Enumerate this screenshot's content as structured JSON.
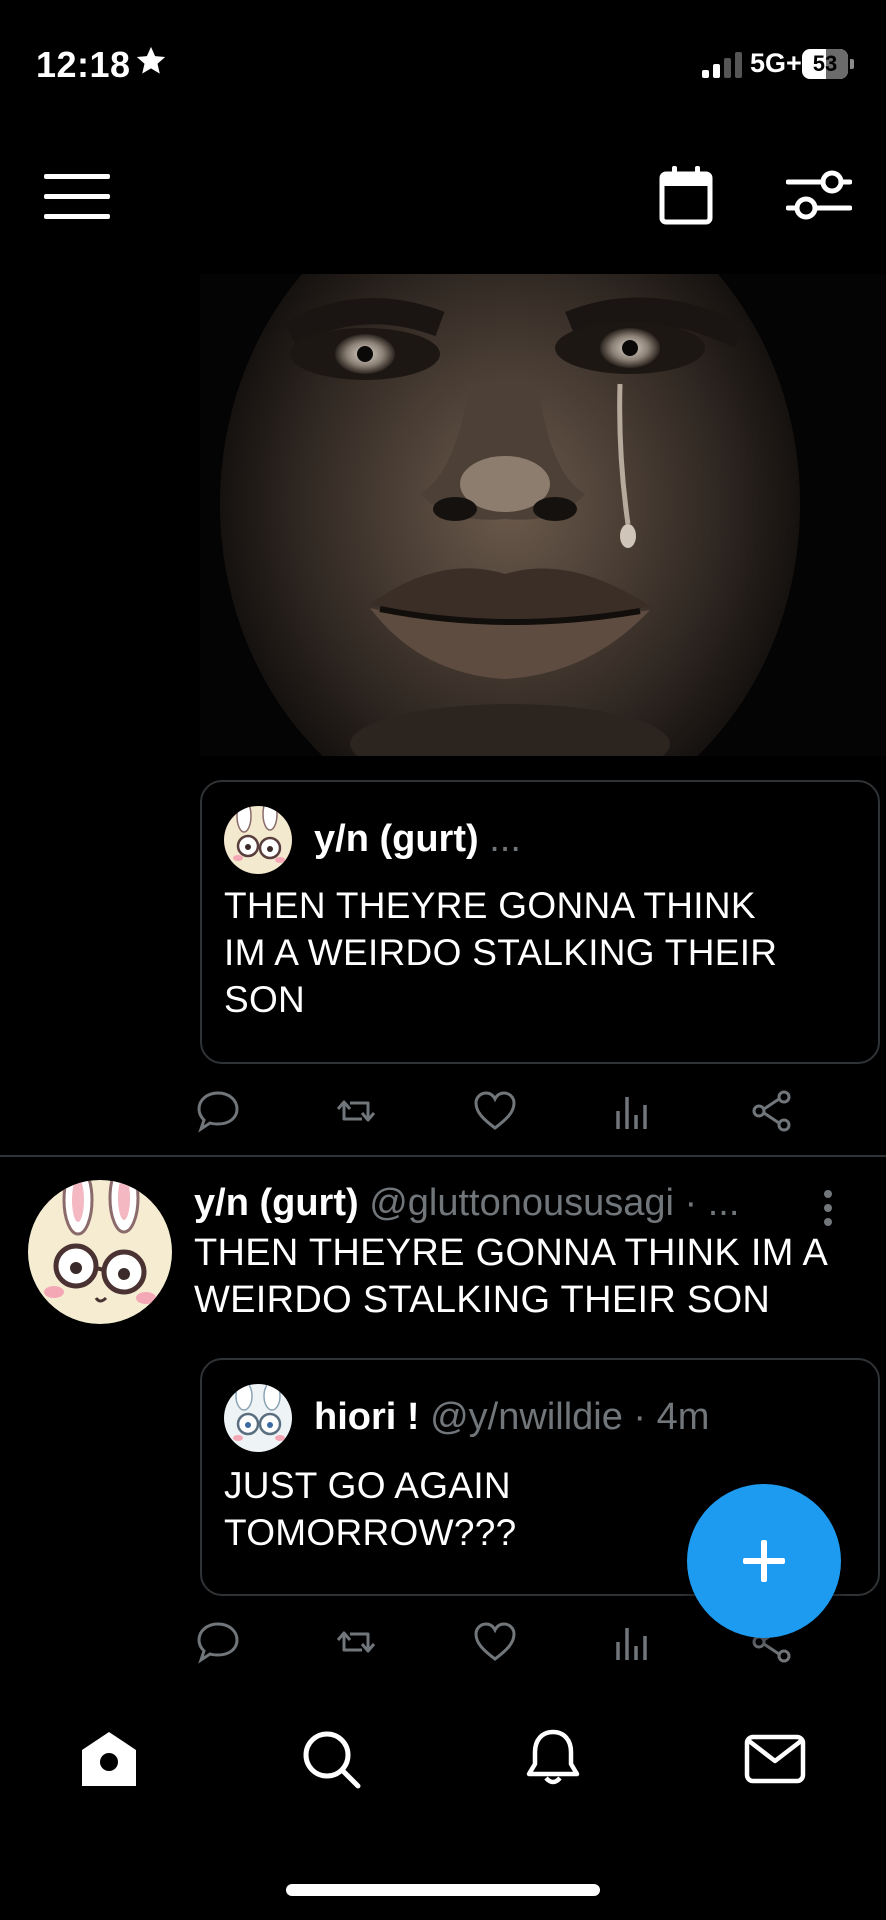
{
  "status": {
    "time": "12:18",
    "network": "5G+",
    "battery": "53",
    "battery_level": 0.53
  },
  "header": {
    "menu_icon": "hamburger-menu-icon",
    "calendar_icon": "calendar-icon",
    "filter_icon": "sliders-icon"
  },
  "post1": {
    "quote": {
      "name": "y/n (gurt)",
      "meta": "...",
      "text_lines": [
        "THEN THEYRE GONNA THINK",
        "IM A WEIRDO STALKING THEIR",
        "SON"
      ]
    }
  },
  "post2": {
    "name": "y/n (gurt)",
    "handle": "@gluttonoususagi · ...",
    "text_lines": [
      "THEN THEYRE GONNA THINK IM A",
      "WEIRDO STALKING THEIR SON"
    ],
    "quote": {
      "name": "hiori !",
      "handle": "@y/nwilldie · 4m",
      "text_lines": [
        "JUST GO AGAIN",
        "TOMORROW???"
      ]
    }
  },
  "actions": [
    "reply-icon",
    "repost-icon",
    "like-icon",
    "views-icon",
    "share-icon"
  ],
  "fab": {
    "icon": "plus-icon"
  },
  "bottom_nav": [
    "home-icon",
    "search-icon",
    "notifications-icon",
    "messages-icon"
  ]
}
